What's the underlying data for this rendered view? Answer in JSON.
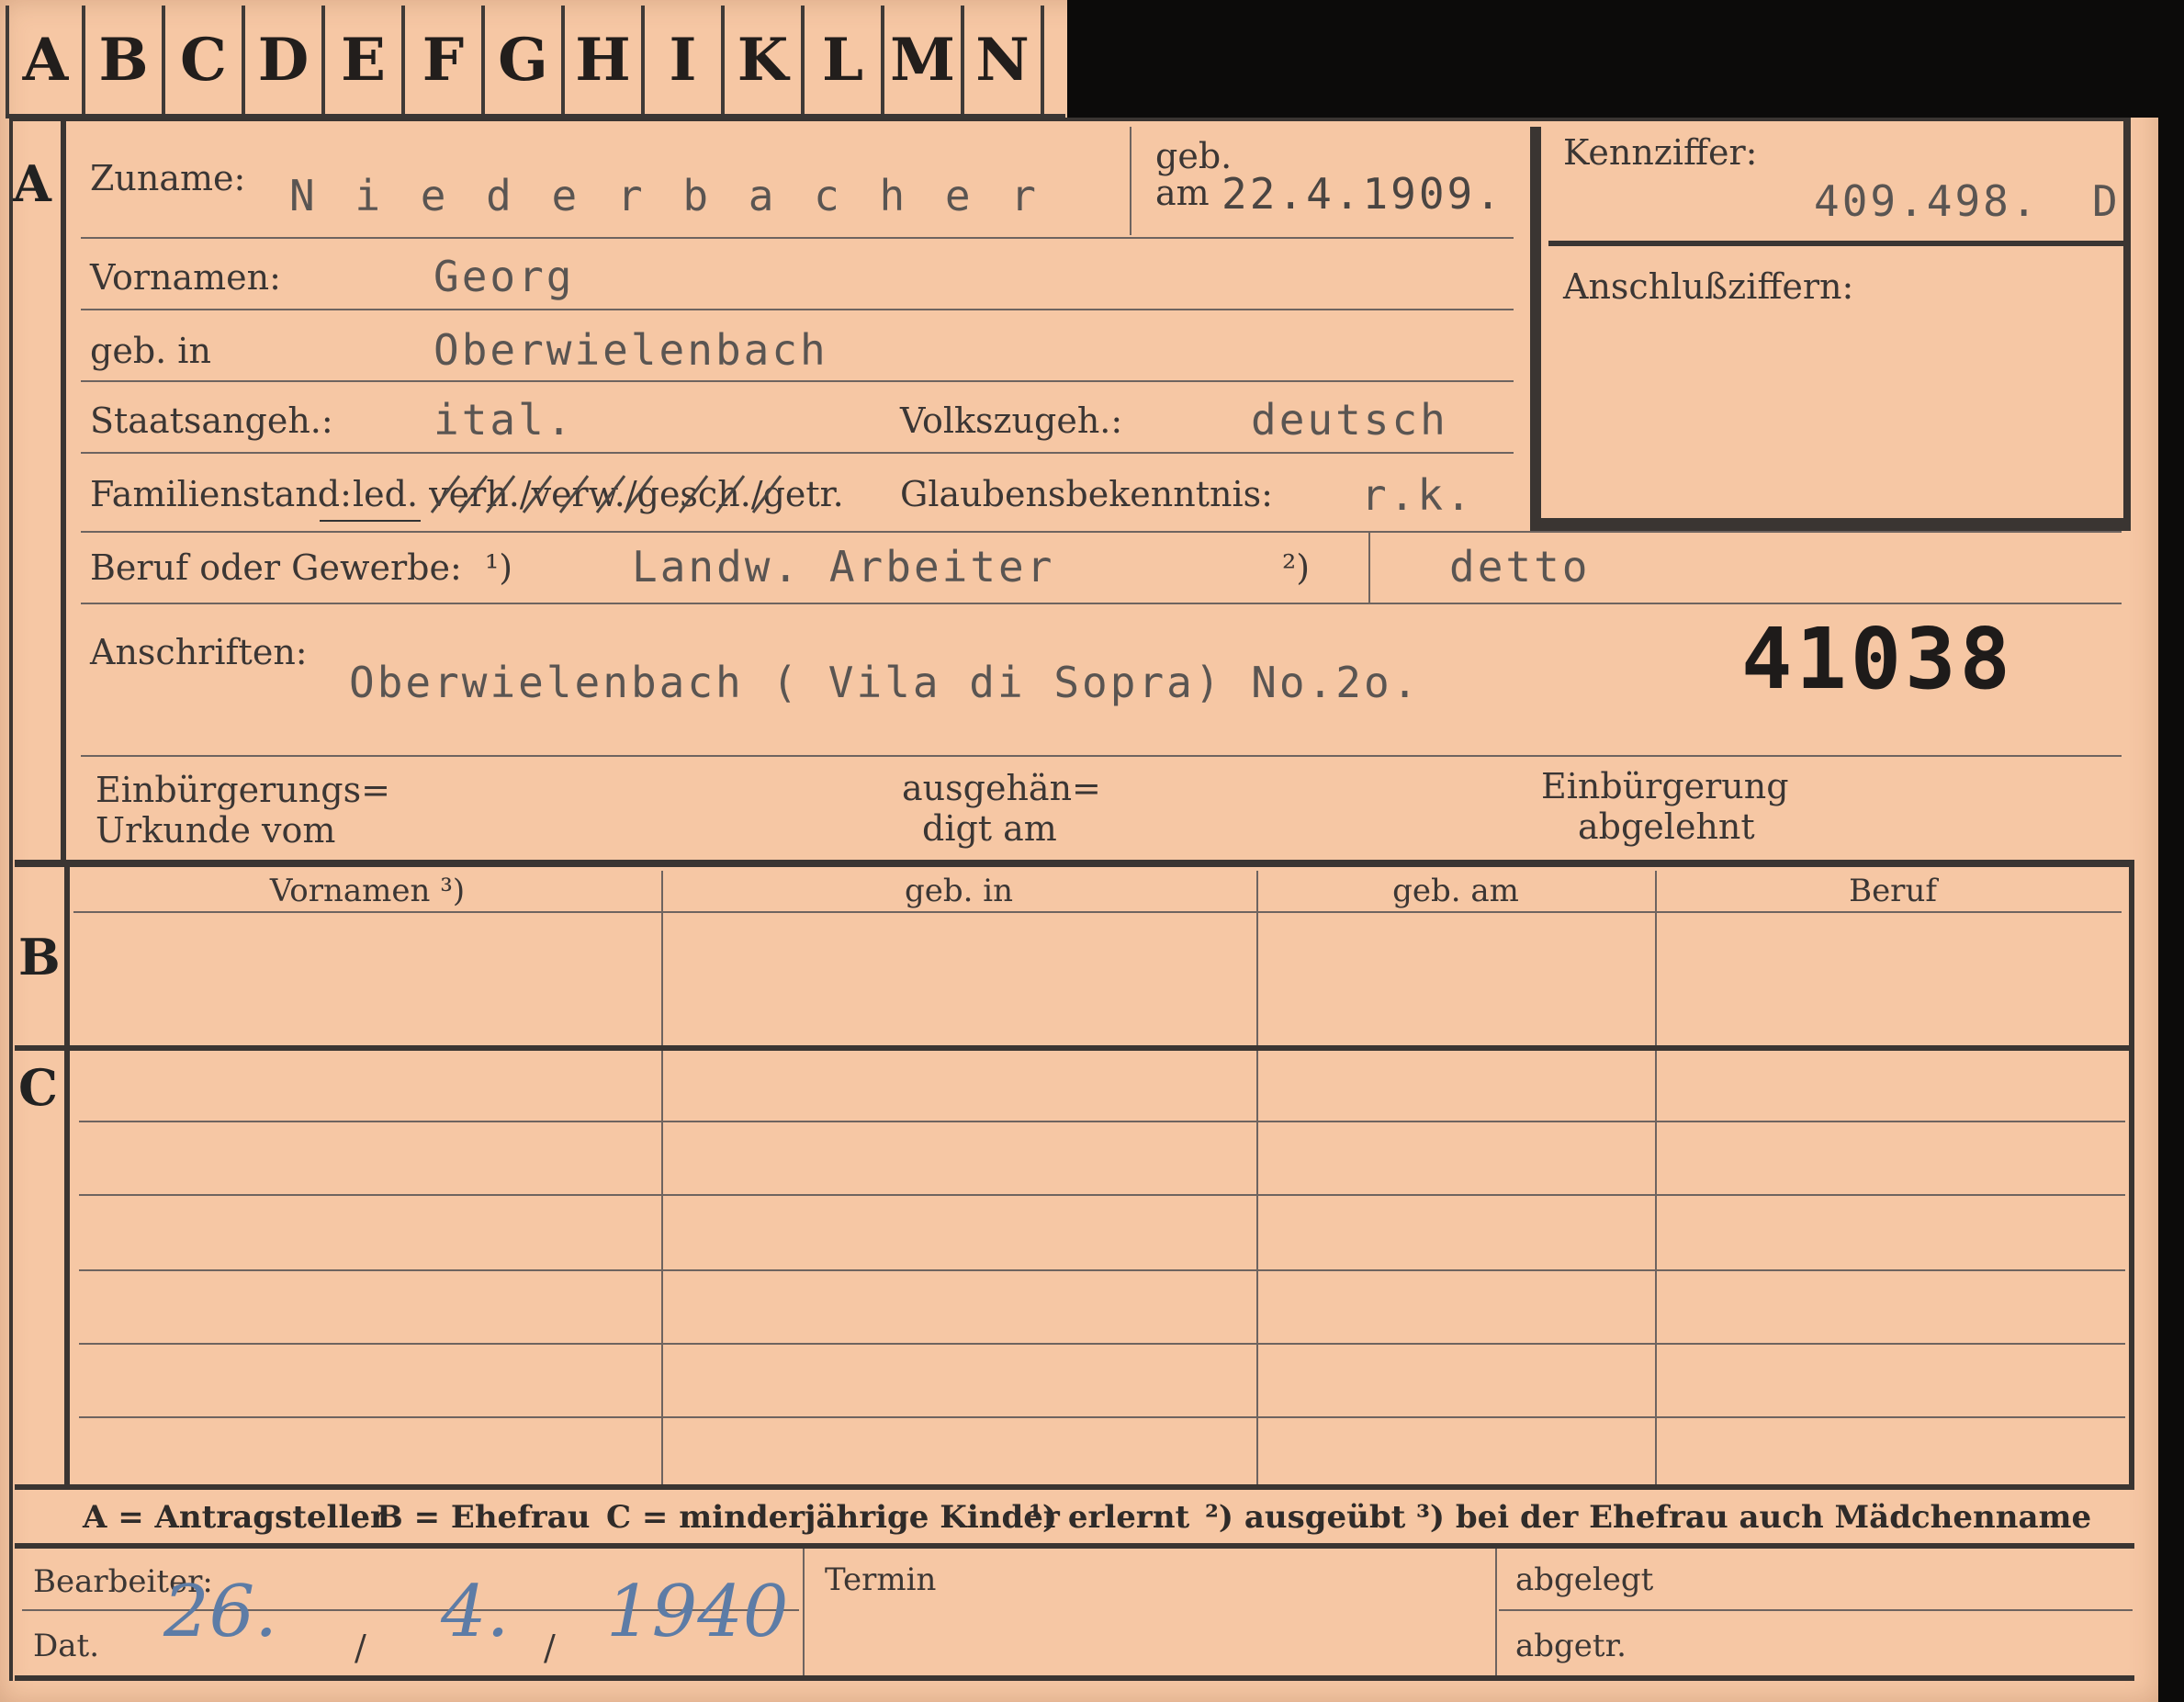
{
  "tabs": [
    "A",
    "B",
    "C",
    "D",
    "E",
    "F",
    "G",
    "H",
    "I",
    "K",
    "L",
    "M",
    "N"
  ],
  "sections": {
    "a": "A",
    "b": "B",
    "c": "C"
  },
  "labels": {
    "surname": "Zuname:",
    "geb_am_1": "geb.",
    "geb_am_2": "am",
    "kennziffer": "Kennziffer:",
    "anschluss": "Anschlußziffern:",
    "vornamen": "Vornamen:",
    "geb_in": "geb. in",
    "staatsangeh": "Staatsangeh.:",
    "volkszugeh": "Volkszugeh.:",
    "familienstand": "Familienstand:",
    "familienstand_opts": "led. verh./verw./gesch./getr.",
    "glauben": "Glaubensbekenntnis:",
    "beruf": "Beruf oder Gewerbe:",
    "note1": "¹)",
    "note2": "²)",
    "anschriften": "Anschriften:",
    "einb_urk_1": "Einbürgerungs=",
    "einb_urk_2": "Urkunde vom",
    "ausgeh_1": "ausgehän=",
    "ausgeh_2": "digt am",
    "einb_abg_1": "Einbürgerung",
    "einb_abg_2": "abgelehnt"
  },
  "values": {
    "surname": "N i e d e r b a c h e r",
    "birth_date": "22.4.1909.",
    "kennziffer": "409.498.",
    "kennziffer_suffix": "D",
    "vornamen": "Georg",
    "geb_in": "Oberwielenbach",
    "staatsangeh": "ital.",
    "volkszugeh": "deutsch",
    "glauben": "r.k.",
    "beruf1": "Landw. Arbeiter",
    "beruf2": "detto",
    "anschrift": "Oberwielenbach ( Vila di Sopra) No.2o.",
    "stamp_number": "41038"
  },
  "table": {
    "headers": [
      "Vornamen ³)",
      "geb. in",
      "geb. am",
      "Beruf"
    ]
  },
  "footnote": {
    "a": "A = Antragsteller",
    "b": "B = Ehefrau",
    "c": "C = minderjährige Kinder",
    "n1": "¹) erlernt",
    "n2": "²) ausgeübt",
    "n3": "³) bei der Ehefrau auch Mädchenname"
  },
  "bottom": {
    "bearbeiter": "Bearbeiter:",
    "dat": "Dat.",
    "termin": "Termin",
    "abgelegt": "abgelegt",
    "abgetr": "abgetr.",
    "date_day": "26.",
    "date_month": "4.",
    "date_year": "1940",
    "slash": "/"
  },
  "colors": {
    "card": "#f6c7a4",
    "ink": "#2e2a28",
    "typewriter": "#5a5552",
    "handwriting": "#5d7ca6"
  }
}
